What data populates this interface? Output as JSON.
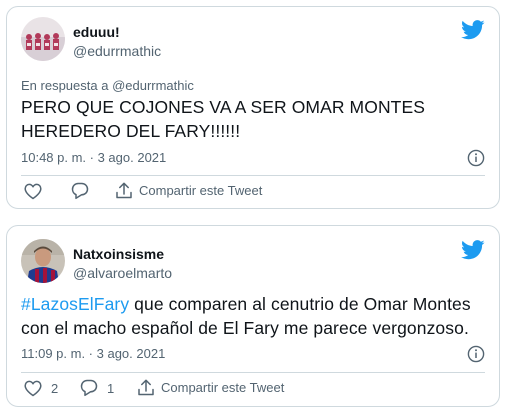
{
  "tweets": [
    {
      "display_name": "eduuu!",
      "handle": "@edurrmathic",
      "reply_prefix": "En respuesta a ",
      "reply_mention": "@edurrmathic",
      "text": "PERO QUE COJONES VA A SER OMAR MONTES HEREDERO DEL FARY!!!!!!",
      "timestamp": "10:48 p. m. · 3 ago. 2021",
      "share_label": "Compartir este Tweet"
    },
    {
      "display_name": "Natxoinsisme",
      "handle": "@alvaroelmarto",
      "hashtag": "#LazosElFary",
      "text_rest": " que comparen al cenutrio de Omar Montes con el macho español de El Fary me parece vergonzoso.",
      "timestamp": "11:09 p. m. · 3 ago. 2021",
      "like_count": "2",
      "reply_count": "1",
      "share_label": "Compartir este Tweet"
    }
  ],
  "colors": {
    "twitter_blue": "#1d9bf0",
    "secondary_text": "#536471",
    "border": "#cfd9de"
  },
  "icons": [
    "twitter-bird-icon",
    "info-icon",
    "heart-icon",
    "reply-icon",
    "share-icon"
  ]
}
